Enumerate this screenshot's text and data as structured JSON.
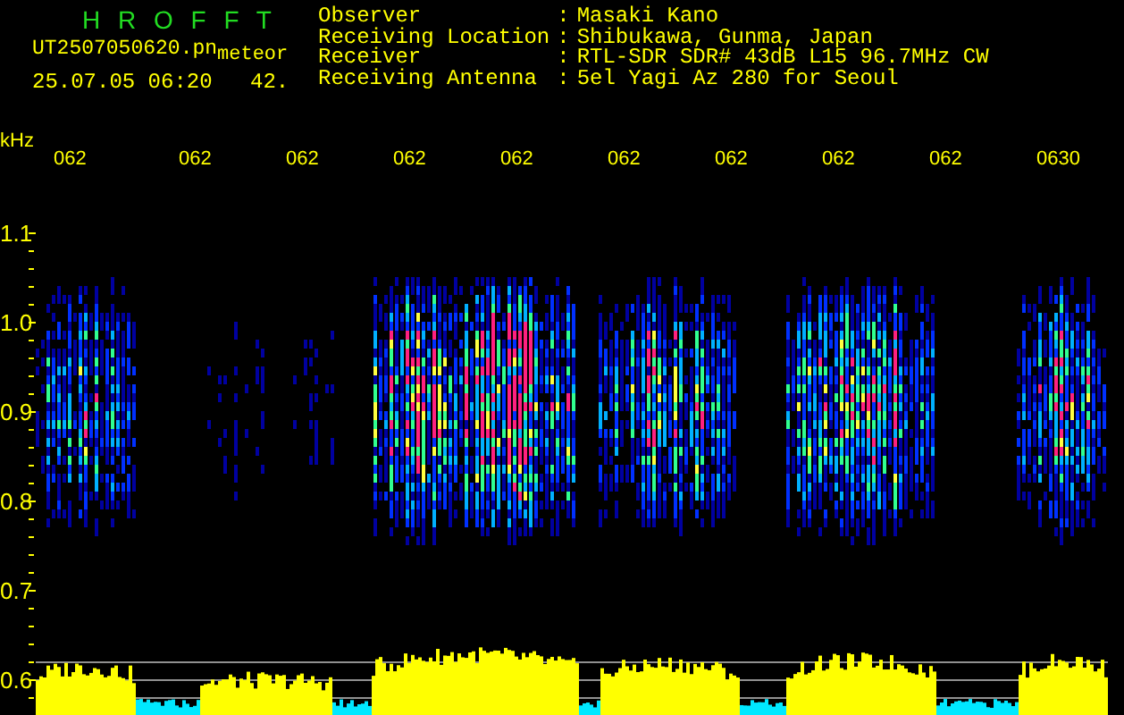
{
  "app": {
    "title": "H R O F F T"
  },
  "file": {
    "name": "UT2507050620.pn",
    "type": "meteor",
    "date_time": "25.07.05 06:20",
    "count": "42."
  },
  "station": [
    {
      "label": "Observer",
      "separator": ":",
      "value": "Masaki Kano"
    },
    {
      "label": "Receiving Location",
      "separator": ":",
      "value": "Shibukawa, Gunma, Japan"
    },
    {
      "label": "Receiver",
      "separator": ":",
      "value": "RTL-SDR SDR# 43dB L15 96.7MHz CW"
    },
    {
      "label": "Receiving Antenna",
      "separator": ":",
      "value": "5el Yagi Az 280 for Seoul"
    }
  ],
  "chart": {
    "y_unit": "kHz",
    "x_labels": [
      "062",
      "062",
      "062",
      "062",
      "062",
      "062",
      "062",
      "062",
      "062",
      "0630"
    ],
    "y_labels": [
      "1.1",
      "1.0",
      "0.9",
      "0.8",
      "0.7",
      "0.6"
    ]
  }
}
